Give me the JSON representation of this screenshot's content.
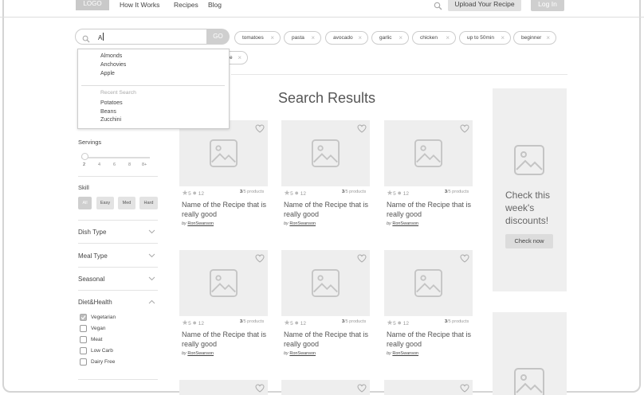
{
  "header": {
    "logo": "LOGO",
    "nav": [
      "How It Works",
      "Recipes",
      "Blog"
    ],
    "upload": "Upload Your Recipe",
    "login": "Log In"
  },
  "search": {
    "value": "A",
    "go": "GO",
    "suggestions": [
      "Almonds",
      "Anchovies",
      "Apple"
    ],
    "recent_title": "Recent Search",
    "recent": [
      "Potatoes",
      "Beans",
      "Zucchini"
    ]
  },
  "chips": [
    "tomatoes",
    "pasta",
    "avocado",
    "garlic",
    "chicken",
    "up to 50min",
    "beginner",
    "e"
  ],
  "sidebar": {
    "servings_title": "Servings",
    "servings_ticks": [
      "2",
      "4",
      "6",
      "8",
      "8+"
    ],
    "servings_value": 2,
    "skill_title": "Skill",
    "skills": [
      "All",
      "Easy",
      "Med",
      "Hard"
    ],
    "dish_type": "Dish Type",
    "meal_type": "Meal Type",
    "seasonal": "Seasonal",
    "diet_title": "Diet&Health",
    "diet_options": [
      {
        "label": "Vegetarian",
        "checked": true
      },
      {
        "label": "Vegan",
        "checked": false
      },
      {
        "label": "Meat",
        "checked": false
      },
      {
        "label": "Low Carb",
        "checked": false
      },
      {
        "label": "Dairy Free",
        "checked": false
      }
    ]
  },
  "results": {
    "title": "Search Results",
    "card": {
      "stars": "5",
      "comments": "12",
      "products_count": "3",
      "products_suffix": "/5 products",
      "title": "Name of the Recipe that is really good",
      "by": "by",
      "author": "RonSwanson"
    }
  },
  "promo": {
    "text": "Check this week's discounts!",
    "button": "Check now"
  }
}
